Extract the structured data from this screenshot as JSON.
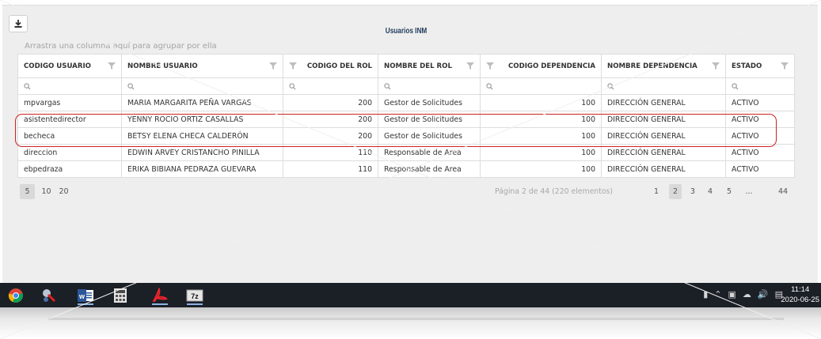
{
  "grid": {
    "title": "Usuarios INM",
    "group_panel": "Arrastra una columna aquí para agrupar por ella",
    "columns": [
      {
        "label": "CODIGO USUARIO"
      },
      {
        "label": "NOMBRE USUARIO"
      },
      {
        "label": "CODIGO DEL ROL"
      },
      {
        "label": "NOMBRE DEL ROL"
      },
      {
        "label": "CODIGO DEPENDENCIA"
      },
      {
        "label": "NOMBRE DEPENDENCIA"
      },
      {
        "label": "ESTADO"
      }
    ],
    "rows": [
      [
        "mpvargas",
        "MARIA MARGARITA PEÑA VARGAS",
        "200",
        "Gestor de Solicitudes",
        "100",
        "DIRECCIÓN GENERAL",
        "ACTIVO"
      ],
      [
        "asistentedirector",
        "YENNY ROCIO ORTIZ CASALLAS",
        "200",
        "Gestor de Solicitudes",
        "100",
        "DIRECCIÓN GENERAL",
        "ACTIVO"
      ],
      [
        "becheca",
        "BETSY ELENA CHECA CALDERÓN",
        "200",
        "Gestor de Solicitudes",
        "100",
        "DIRECCIÓN GENERAL",
        "ACTIVO"
      ],
      [
        "direccion",
        "EDWIN ARVEY CRISTANCHO PINILLA",
        "110",
        "Responsable de Area",
        "100",
        "DIRECCIÓN GENERAL",
        "ACTIVO"
      ],
      [
        "ebpedraza",
        "ERIKA BIBIANA PEDRAZA GUEVARA",
        "110",
        "Responsable de Area",
        "100",
        "DIRECCIÓN GENERAL",
        "ACTIVO"
      ]
    ],
    "highlighted_rows": [
      1,
      2
    ],
    "highlight_color": "#cc2222"
  },
  "pager": {
    "sizes": [
      "5",
      "10",
      "20"
    ],
    "selected_size": "5",
    "info": "Página 2 de 44 (220 elementos)",
    "pages": [
      "1",
      "2",
      "3",
      "4",
      "5",
      "...",
      "44"
    ],
    "current_page": "2"
  },
  "taskbar": {
    "apps": [
      "chrome-icon",
      "snipping-tool-icon",
      "word-icon",
      "calculator-icon",
      "acrobat-icon",
      "7zip-icon"
    ],
    "time": "11:14",
    "date": "2020-06-25"
  },
  "colors": {
    "background": "#eeeeee",
    "taskbar": "#1b1f26",
    "title": "#1f3a5a"
  }
}
